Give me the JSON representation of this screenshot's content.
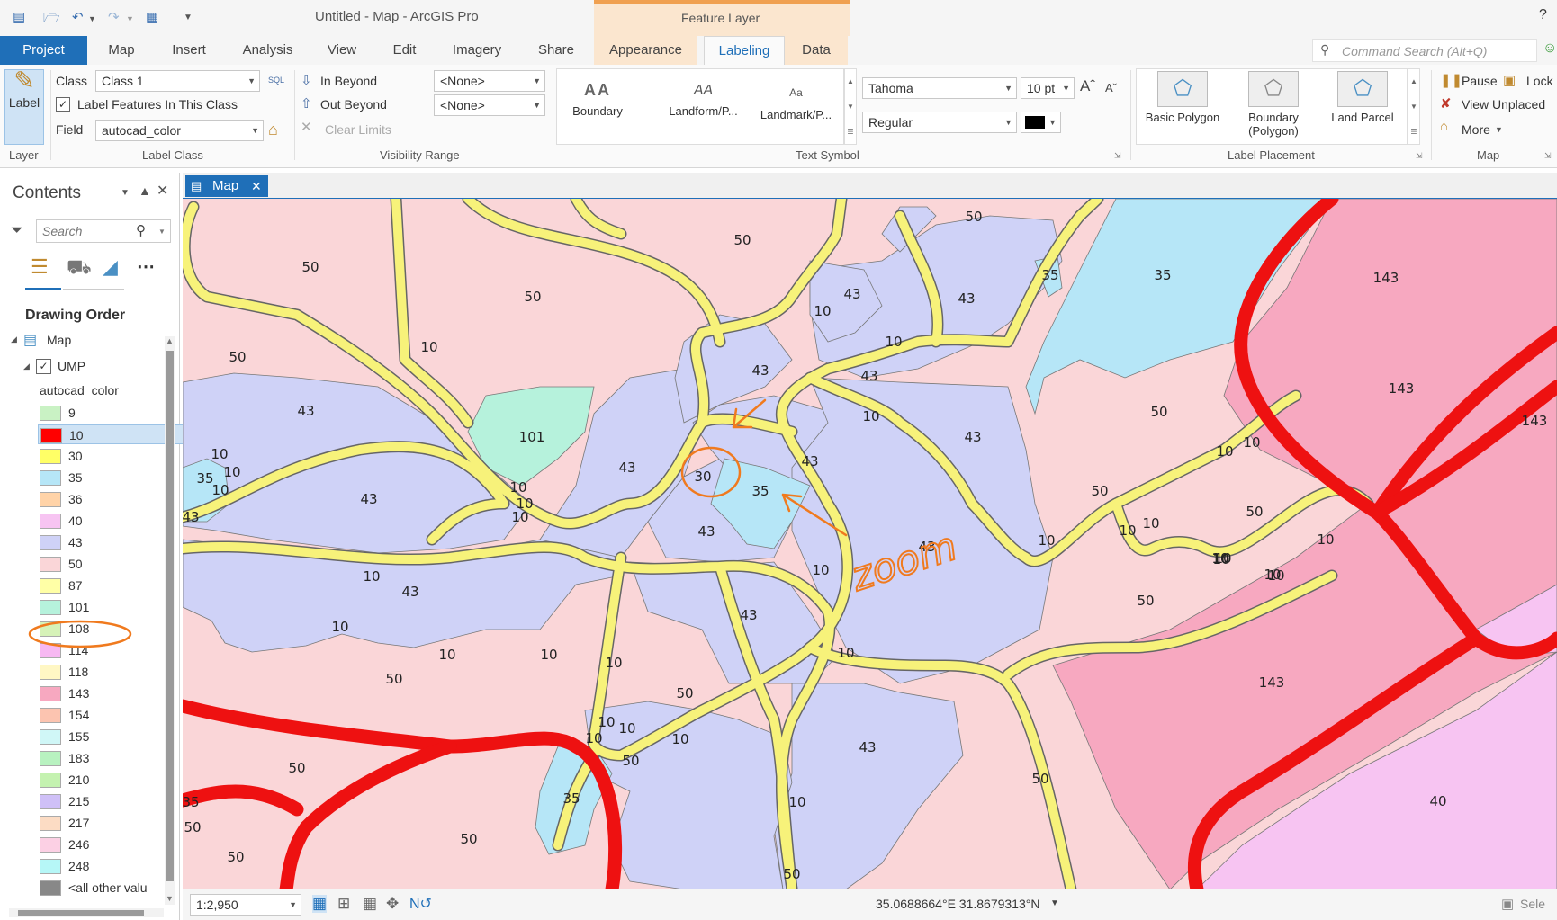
{
  "titlebar": {
    "title": "Untitled - Map - ArcGIS Pro",
    "context_label": "Feature Layer",
    "help": "?"
  },
  "tabs": [
    {
      "label": "Project",
      "active": true
    },
    {
      "label": "Map"
    },
    {
      "label": "Insert"
    },
    {
      "label": "Analysis"
    },
    {
      "label": "View"
    },
    {
      "label": "Edit"
    },
    {
      "label": "Imagery"
    },
    {
      "label": "Share"
    },
    {
      "label": "Appearance"
    },
    {
      "label": "Labeling",
      "selected": true
    },
    {
      "label": "Data"
    }
  ],
  "search": {
    "placeholder": "Command Search (Alt+Q)"
  },
  "ribbon": {
    "layer": {
      "label_button": "Label",
      "group": "Layer"
    },
    "label_class": {
      "class_label": "Class",
      "class_value": "Class 1",
      "label_features": "Label Features In This Class",
      "field_label": "Field",
      "field_value": "autocad_color",
      "group": "Label Class"
    },
    "visibility": {
      "in_beyond": "In Beyond",
      "out_beyond": "Out Beyond",
      "clear_limits": "Clear Limits",
      "in_value": "<None>",
      "out_value": "<None>",
      "group": "Visibility Range"
    },
    "text_symbol": {
      "styles": [
        "Boundary",
        "Landform/P...",
        "Landmark/P..."
      ],
      "font": "Tahoma",
      "size": "10 pt",
      "style": "Regular",
      "color": "#000000",
      "group": "Text Symbol"
    },
    "label_placement": {
      "items": [
        "Basic Polygon",
        "Boundary (Polygon)",
        "Land Parcel"
      ],
      "group": "Label Placement"
    },
    "map": {
      "pause": "Pause",
      "lock": "Lock",
      "view_unplaced": "View Unplaced",
      "more": "More",
      "group": "Map"
    }
  },
  "contents": {
    "title": "Contents",
    "search_placeholder": "Search",
    "drawing_order": "Drawing Order",
    "map_node": "Map",
    "layer_node": "UMP",
    "field": "autocad_color",
    "legend": [
      {
        "label": "9",
        "color": "#c9f2c4"
      },
      {
        "label": "10",
        "color": "#ff0000",
        "selected": true
      },
      {
        "label": "30",
        "color": "#ffff66"
      },
      {
        "label": "35",
        "color": "#b6e6f7"
      },
      {
        "label": "36",
        "color": "#ffd3a8"
      },
      {
        "label": "40",
        "color": "#f7c4f2"
      },
      {
        "label": "43",
        "color": "#cfd2f7"
      },
      {
        "label": "50",
        "color": "#fad6d8"
      },
      {
        "label": "87",
        "color": "#ffffa6"
      },
      {
        "label": "101",
        "color": "#b6f2dc"
      },
      {
        "label": "108",
        "color": "#d6f2b8"
      },
      {
        "label": "114",
        "color": "#f7b8f2"
      },
      {
        "label": "118",
        "color": "#fff7c4"
      },
      {
        "label": "143",
        "color": "#f7a8c0"
      },
      {
        "label": "154",
        "color": "#fcc4b0"
      },
      {
        "label": "155",
        "color": "#d0f7f7"
      },
      {
        "label": "183",
        "color": "#b8f2c0"
      },
      {
        "label": "210",
        "color": "#c4f2b0"
      },
      {
        "label": "215",
        "color": "#cfc0f7"
      },
      {
        "label": "217",
        "color": "#fcdcc4"
      },
      {
        "label": "246",
        "color": "#fcd0e4"
      },
      {
        "label": "248",
        "color": "#b6f7f7"
      },
      {
        "label": "<all other valu",
        "color": "#888888"
      }
    ]
  },
  "map_tab": {
    "label": "Map"
  },
  "map_labels": [
    "50",
    "50",
    "50",
    "50",
    "50",
    "43",
    "43",
    "43",
    "43",
    "43",
    "43",
    "43",
    "43",
    "43",
    "43",
    "43",
    "43",
    "43",
    "43",
    "43",
    "35",
    "35",
    "35",
    "35",
    "35",
    "35",
    "101",
    "30",
    "143",
    "143",
    "143",
    "143",
    "40",
    "10",
    "10",
    "10",
    "10",
    "10",
    "10",
    "10",
    "10",
    "10",
    "10",
    "10",
    "10",
    "10",
    "10",
    "10",
    "10",
    "10",
    "10",
    "10",
    "10",
    "10",
    "10",
    "10",
    "10",
    "10",
    "10",
    "10",
    "10",
    "10",
    "10",
    "10",
    "10",
    "10",
    "10",
    "50",
    "50",
    "50",
    "50",
    "50",
    "50",
    "50",
    "50",
    "50",
    "50",
    "50",
    "50",
    "50",
    "50",
    "50"
  ],
  "annotation": {
    "text": "zoom"
  },
  "statusbar": {
    "scale": "1:2,950",
    "coords": "35.0688664°E 31.8679313°N",
    "selected": "Sele"
  }
}
